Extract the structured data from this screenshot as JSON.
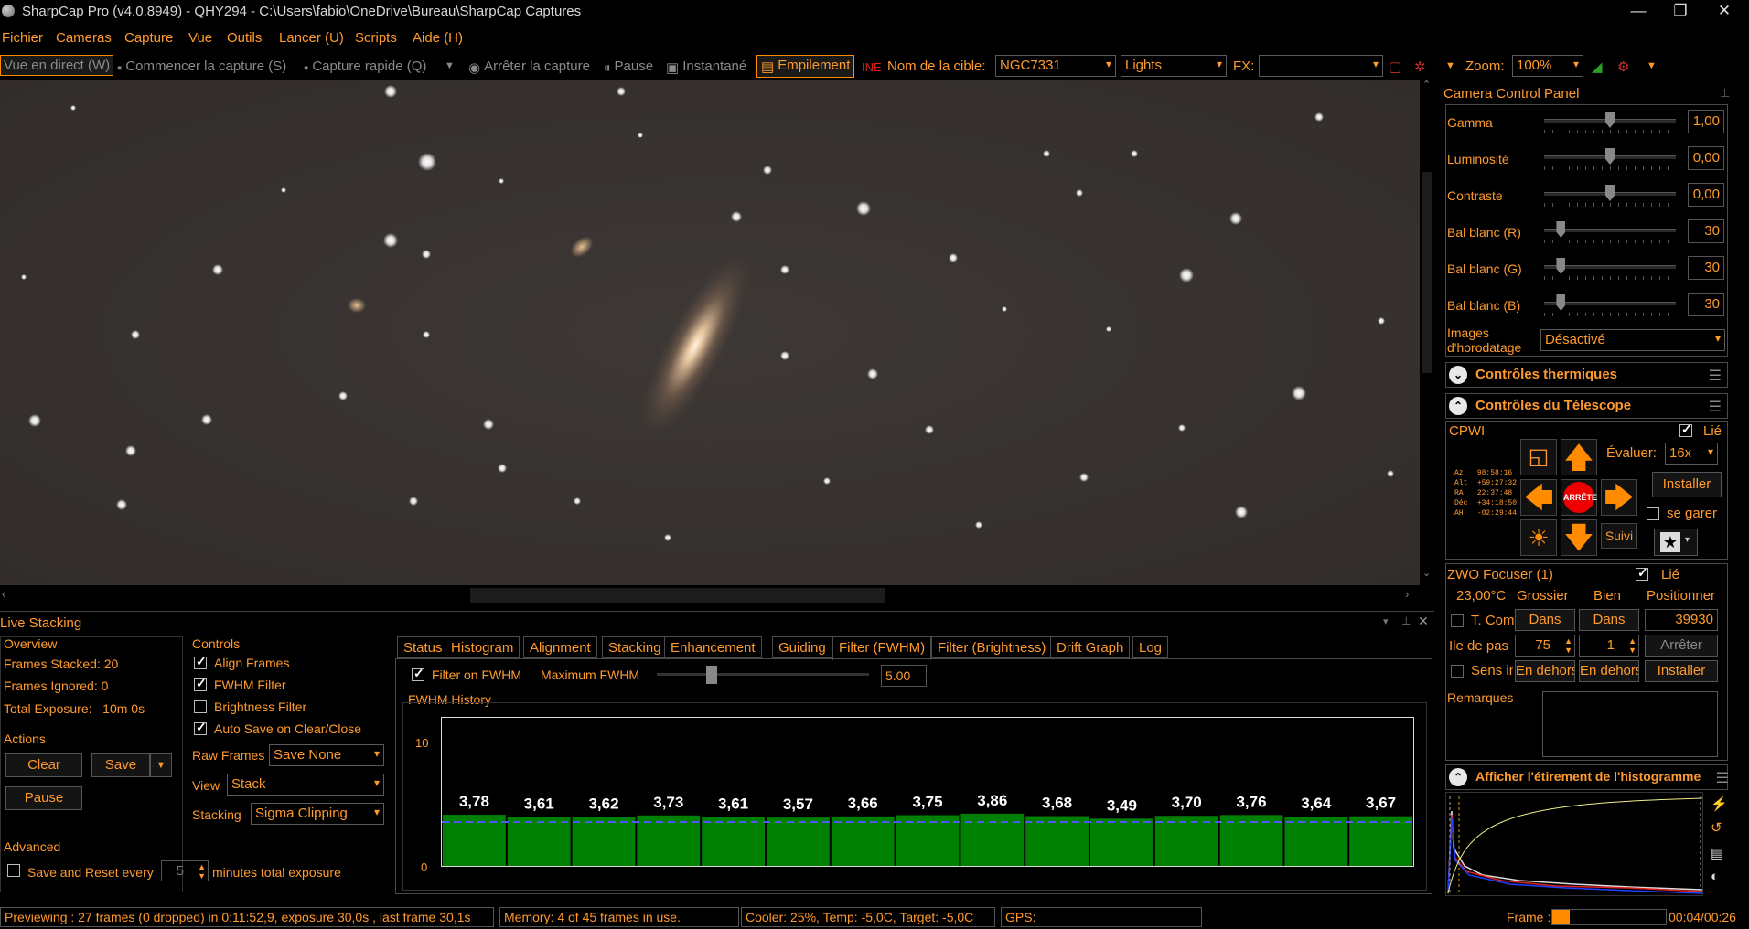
{
  "title": "SharpCap Pro (v4.0.8949) - QHY294 - C:\\Users\\fabio\\OneDrive\\Bureau\\SharpCap Captures",
  "menu": [
    "Fichier",
    "Cameras",
    "Capture",
    "Vue",
    "Outils",
    "Lancer (U)",
    "Scripts",
    "Aide (H)"
  ],
  "toolbar": {
    "live": "Vue en direct (W)",
    "start": "Commencer la capture (S)",
    "quick": "Capture rapide (Q)",
    "stop": "Arrêter la capture",
    "pause": "Pause",
    "snapshot": "Instantané",
    "stacking": "Empilement",
    "target_label": "Nom de la cible:",
    "target": "NGC7331",
    "frame_type": "Lights",
    "fx_label": "FX:",
    "fx": "",
    "zoom_label": "Zoom:",
    "zoom": "100%"
  },
  "ccp": {
    "title": "Camera Control Panel",
    "sliders": [
      {
        "label": "Gamma",
        "value": "1,00",
        "pos": 0.5
      },
      {
        "label": "Luminosité",
        "value": "0,00",
        "pos": 0.5
      },
      {
        "label": "Contraste",
        "value": "0,00",
        "pos": 0.5
      },
      {
        "label": "Bal blanc (R)",
        "value": "30",
        "pos": 0.1
      },
      {
        "label": "Bal blanc (G)",
        "value": "30",
        "pos": 0.1
      },
      {
        "label": "Bal blanc (B)",
        "value": "30",
        "pos": 0.1
      }
    ],
    "timestamp_label1": "Images",
    "timestamp_label2": "d'horodatage",
    "timestamp_value": "Désactivé"
  },
  "thermal": {
    "title": "Contrôles thermiques"
  },
  "telescope": {
    "title": "Contrôles du Télescope",
    "mount": "CPWI",
    "linked": "Lié",
    "rate_label": "Évaluer:",
    "rate": "16x",
    "install": "Installer",
    "park": "se garer",
    "stop": "ARRÊTE",
    "track": "Suivi",
    "coords": [
      {
        "k": "Az",
        "v": "98:58:16"
      },
      {
        "k": "Alt",
        "v": "+59:27:32"
      },
      {
        "k": "RA",
        "v": "22:37:48"
      },
      {
        "k": "Déc",
        "v": "+34:18:50"
      },
      {
        "k": "AH",
        "v": "-02:29:44"
      }
    ]
  },
  "focuser": {
    "title": "ZWO Focuser (1)",
    "linked": "Lié",
    "temp": "23,00°C",
    "coarse": "Grossier",
    "fine": "Bien",
    "position_label": "Positionner",
    "tcomp": "T. Com",
    "in1": "Dans",
    "in2": "Dans",
    "position": "39930",
    "step_label": "Ile de pas",
    "coarse_step": "75",
    "fine_step": "1",
    "stop": "Arrêter",
    "reverse": "Sens in",
    "out1": "En dehors",
    "out2": "En dehors",
    "install": "Installer",
    "notes": "Remarques"
  },
  "histo_stretch": {
    "title": "Afficher l'étirement de l'histogramme"
  },
  "live": {
    "title": "Live Stacking",
    "overview": "Overview",
    "stacked": "Frames Stacked: 20",
    "ignored": "Frames Ignored: 0",
    "exposure": "Total Exposure:   10m 0s",
    "actions": "Actions",
    "clear": "Clear",
    "save": "Save",
    "pause": "Pause",
    "advanced": "Advanced",
    "save_reset": "Save and Reset every",
    "minutes": "5",
    "minutes_label": "minutes total exposure",
    "controls": "Controls",
    "align": "Align Frames",
    "fwhm": "FWHM Filter",
    "brightness": "Brightness Filter",
    "autosave": "Auto Save on Clear/Close",
    "raw_label": "Raw Frames",
    "raw": "Save None",
    "view_label": "View",
    "view": "Stack",
    "stacking_label": "Stacking",
    "stacking": "Sigma Clipping"
  },
  "tabs": [
    "Status",
    "Histogram",
    "Alignment",
    "Stacking",
    "Enhancement",
    "Guiding",
    "Filter (FWHM)",
    "Filter (Brightness)",
    "Drift Graph",
    "Log"
  ],
  "fwhm": {
    "filter_on": "Filter on FWHM",
    "max_label": "Maximum FWHM",
    "max_value": "5.00",
    "history": "FWHM History"
  },
  "chart_data": {
    "type": "bar",
    "values": [
      3.78,
      3.61,
      3.62,
      3.73,
      3.61,
      3.57,
      3.66,
      3.75,
      3.86,
      3.68,
      3.49,
      3.7,
      3.76,
      3.64,
      3.67
    ],
    "labels": [
      "3,78",
      "3,61",
      "3,62",
      "3,73",
      "3,61",
      "3,57",
      "3,66",
      "3,75",
      "3,86",
      "3,68",
      "3,49",
      "3,70",
      "3,76",
      "3,64",
      "3,67"
    ],
    "ylim": [
      0,
      10
    ],
    "yticks": [
      "10",
      "0"
    ],
    "threshold": 5.0,
    "bar_color": "#008000",
    "line_color": "#5555ff"
  },
  "status": {
    "preview": "Previewing : 27 frames (0 dropped) in 0:11:52,9, exposure 30,0s , last frame 30,1s",
    "memory": "Memory: 4 of 45 frames in use.",
    "cooler": "Cooler: 25%, Temp: -5,0C, Target: -5,0C",
    "gps": "GPS:",
    "frame_label": "Frame :",
    "frame_time": "00:04/00:26",
    "frame_progress": 0.15
  }
}
